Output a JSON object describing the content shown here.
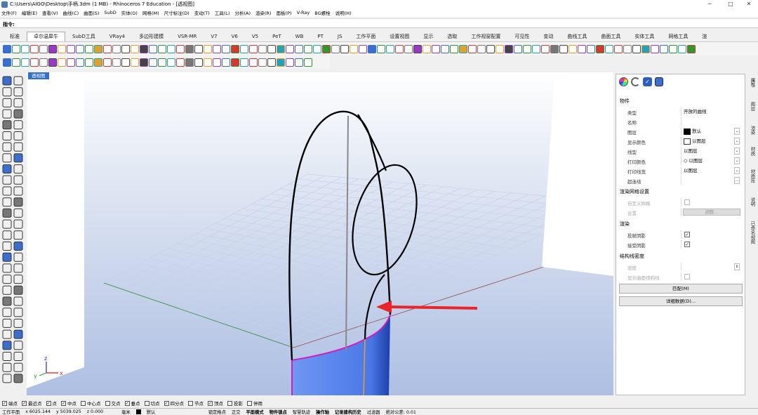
{
  "window": {
    "title": "C:\\Users\\AIGO\\Desktop\\手柄.3dm (1 MB) - Rhinoceros 7 Education - [透视图]",
    "minimize": "─",
    "maximize": "□",
    "close": "✕"
  },
  "menu": [
    "文件(F)",
    "编辑(E)",
    "查看(V)",
    "曲线(C)",
    "曲面(S)",
    "SubD",
    "实体(O)",
    "网格(M)",
    "尺寸标注(D)",
    "变动(T)",
    "工具(L)",
    "分析(A)",
    "渲染(R)",
    "面板(P)",
    "V-Ray",
    "BG螺栓",
    "说明(H)"
  ],
  "command": {
    "label": "指令:"
  },
  "tabs": [
    "标准",
    "卓尔温犀牛",
    "SubD工具",
    "VRay4",
    "多边形建模",
    "VSR-MR",
    "V7",
    "V6",
    "V5",
    "PeT",
    "WB",
    "PT",
    "JS",
    "工作平面",
    "设置视图",
    "显示",
    "选取",
    "工作视窗配置",
    "可见性",
    "变动",
    "曲线工具",
    "曲面工具",
    "实体工具",
    "网格工具",
    "渲"
  ],
  "active_tab": "卓尔温犀牛",
  "viewport": {
    "label": "透视图"
  },
  "axes": {
    "x": "x",
    "y": "y",
    "z": "z"
  },
  "panel": {
    "icons": [
      "color-wheel-icon",
      "light-icon",
      "info-icon",
      "cylinder-icon"
    ],
    "section_object": "物件",
    "rows": [
      {
        "label": "类型",
        "value": "开放的曲线"
      },
      {
        "label": "名称",
        "value": ""
      },
      {
        "label": "图层",
        "value": "默认",
        "swatch": "#000000"
      },
      {
        "label": "显示颜色",
        "value": "以图层"
      },
      {
        "label": "线型",
        "value": "以图层"
      },
      {
        "label": "打印颜色",
        "value": "以图层"
      },
      {
        "label": "打印线宽",
        "value": "以图层"
      },
      {
        "label": "超连结",
        "value": ""
      }
    ],
    "section_mesh": "渲染网格设置",
    "custom_mesh": "自定义网格",
    "settings": "设置",
    "adjust_btn": "调整...",
    "section_render": "渲染",
    "cast_shadow": "投射阴影",
    "receive_shadow": "接受阴影",
    "section_iso": "结构线密度",
    "density": "密度",
    "show_iso": "显示曲面结构线",
    "match_btn": "匹配(M)",
    "details_btn": "详细数据(D)..."
  },
  "right_tabs": [
    "属性",
    "图层",
    "渲染",
    "材质",
    "材质库",
    "说明",
    "已命名视图"
  ],
  "osnaps": [
    {
      "label": "端点",
      "on": true
    },
    {
      "label": "最近点",
      "on": true
    },
    {
      "label": "点",
      "on": true
    },
    {
      "label": "中点",
      "on": true
    },
    {
      "label": "中心点",
      "on": false
    },
    {
      "label": "交点",
      "on": false
    },
    {
      "label": "垂点",
      "on": true
    },
    {
      "label": "切点",
      "on": false
    },
    {
      "label": "四分点",
      "on": true
    },
    {
      "label": "节点",
      "on": false
    },
    {
      "label": "顶点",
      "on": true
    },
    {
      "label": "投影",
      "on": false
    },
    {
      "label": "停用",
      "on": false
    }
  ],
  "status": {
    "plane": "工作平面",
    "x": "x 6025.144",
    "y": "y 5039.025",
    "z": "z 0.000",
    "unit": "毫米",
    "layer": "默认",
    "items": [
      "锁定格点",
      "正交",
      "平面模式",
      "物件锁点",
      "智慧轨迹",
      "操作轴",
      "记录建构历史",
      "过滤器"
    ],
    "tolerance": "绝对公差: 0.01"
  },
  "colors": {
    "accent": "#2f6fcf",
    "arrow": "#e8262a",
    "surface": "#4a78e8",
    "edge_magenta": "#d020c0",
    "edge_orange": "#e8a020"
  }
}
